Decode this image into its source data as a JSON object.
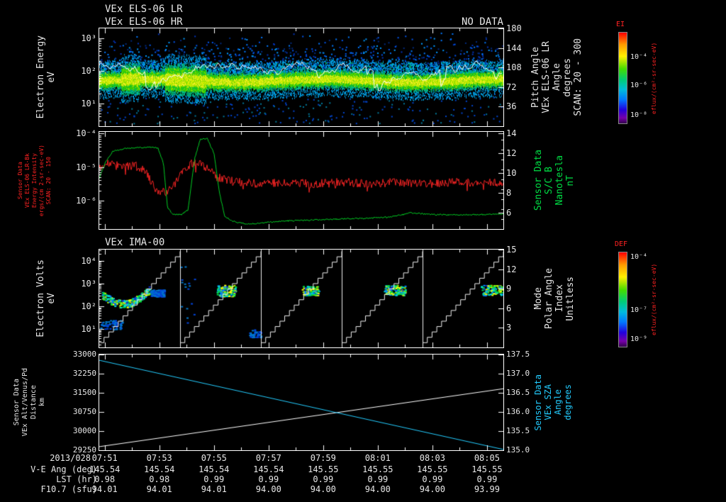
{
  "header": {
    "title_line1": "VEx ELS-06 LR",
    "title_line2": "VEx ELS-06 HR",
    "no_data": "NO DATA"
  },
  "panel_titles": {
    "ima": "VEx IMA-00"
  },
  "left_labels": {
    "els": [
      "Electron Energy",
      "eV"
    ],
    "bfield_red": [
      "Sensor Data",
      "VEx ELS-06 LR-Bk",
      "Energy Intensity",
      "ergs/(cm 2-sr-sec-eV)",
      "SCAN: 20 - 150"
    ],
    "ima": [
      "Electron Volts",
      "eV"
    ],
    "alt": [
      "Sensor Data",
      "VEx Alt/Venus/Pd",
      "Distance",
      "km"
    ]
  },
  "right_labels": {
    "els": [
      "Pitch Angle",
      "VEx ELS-06 LR",
      "Angle",
      "degrees",
      "SCAN: 20 - 300"
    ],
    "bfield": [
      "Sensor Data",
      "S/C B",
      "Nanotesla",
      "nT"
    ],
    "ima": [
      "Mode",
      "Polar Angle",
      "Index",
      "Unitless"
    ],
    "alt": [
      "Sensor Data",
      "VEx SZA",
      "Angle",
      "degrees"
    ]
  },
  "axis_ticks": {
    "els_left": [
      "10³",
      "10²",
      "10¹"
    ],
    "els_right": [
      "180",
      "144",
      "108",
      "72",
      "36"
    ],
    "bfield_left": [
      "10⁻⁴",
      "10⁻⁵",
      "10⁻⁶"
    ],
    "bfield_right": [
      "14",
      "12",
      "10",
      "8",
      "6"
    ],
    "ima_left": [
      "10⁴",
      "10³",
      "10²",
      "10¹"
    ],
    "ima_right": [
      "15",
      "12",
      "9",
      "6",
      "3"
    ],
    "alt_left": [
      "33000",
      "32250",
      "31500",
      "30750",
      "30000",
      "29250"
    ],
    "alt_right": [
      "137.5",
      "137.0",
      "136.5",
      "136.0",
      "135.5",
      "135.0"
    ]
  },
  "colorbars": [
    {
      "title": "EI",
      "ticks": [
        "10⁻⁴",
        "10⁻⁶",
        "10⁻⁸"
      ],
      "unit": "eflux/(cm²-sr-sec-eV)"
    },
    {
      "title": "DEF",
      "ticks": [
        "10⁻⁴",
        "10⁻⁷",
        "10⁻⁹"
      ],
      "unit": "eflux/(cm²-sr-sec-eV)"
    }
  ],
  "time_axis": {
    "date": "2013/028",
    "labels": [
      "07:51",
      "07:53",
      "07:55",
      "07:57",
      "07:59",
      "08:01",
      "08:03",
      "08:05"
    ]
  },
  "rows": [
    {
      "label": "V-E Ang (deg)",
      "values": [
        "145.54",
        "145.54",
        "145.54",
        "145.54",
        "145.55",
        "145.55",
        "145.55",
        "145.55"
      ]
    },
    {
      "label": "LST (hr)",
      "values": [
        "0.98",
        "0.98",
        "0.99",
        "0.99",
        "0.99",
        "0.99",
        "0.99",
        "0.99"
      ]
    },
    {
      "label": "F10.7 (sfu)",
      "values": [
        "94.01",
        "94.01",
        "94.01",
        "94.00",
        "94.00",
        "94.00",
        "94.00",
        "93.99"
      ]
    }
  ],
  "chart_data": [
    {
      "type": "heatmap",
      "name": "VEx ELS-06 LR electron energy spectrogram",
      "x_axis": {
        "start": "07:51",
        "end": "08:06",
        "units": "UT"
      },
      "ylog_range": [
        0.3,
        3.3
      ],
      "ytick_values": [
        3,
        2,
        1
      ],
      "y2_range": [
        0,
        180
      ],
      "y2tick_values": [
        180,
        144,
        108,
        72,
        36
      ],
      "features": {
        "band": {
          "log_e_center": 1.72,
          "log_e_halfwidth": 0.25,
          "note": "continuous bright yellow-green 30-100 eV electron band across whole interval"
        },
        "enhancements": [
          [
            0.8,
            1.5
          ],
          [
            2.4,
            3.9
          ]
        ],
        "speckle": {
          "log_e_range": [
            1.9,
            3.2
          ],
          "note": "sparse blue suprathermal counts up to ~1 keV"
        },
        "trace": {
          "note": "white line fluctuating near 100 eV"
        }
      }
    },
    {
      "type": "line",
      "name": "energy intensity and magnetic field",
      "yaxis_left": {
        "log_top": -3.95,
        "log_bottom": -6.85,
        "ytick_values": [
          -4,
          -5,
          -6
        ]
      },
      "yaxis_right": {
        "top": 14.14,
        "bottom": 4.36,
        "ytick_values": [
          14,
          12,
          10,
          8,
          6
        ]
      },
      "series": [
        {
          "name": "VEx ELS-06 LR-Bk Energy Intensity",
          "color": "#ee2222",
          "axis": "left",
          "noise": 0.13,
          "points": [
            [
              0,
              -4.95
            ],
            [
              0.4,
              -4.9
            ],
            [
              0.8,
              -5.0
            ],
            [
              1.3,
              -4.95
            ],
            [
              1.7,
              -5.15
            ],
            [
              2.1,
              -5.7
            ],
            [
              2.5,
              -5.75
            ],
            [
              2.8,
              -5.45
            ],
            [
              3.05,
              -5.1
            ],
            [
              3.3,
              -4.92
            ],
            [
              3.6,
              -4.88
            ],
            [
              3.9,
              -5.0
            ],
            [
              4.3,
              -5.3
            ],
            [
              5,
              -5.45
            ],
            [
              6,
              -5.5
            ],
            [
              7,
              -5.45
            ],
            [
              8,
              -5.5
            ],
            [
              9,
              -5.45
            ],
            [
              10,
              -5.5
            ],
            [
              11,
              -5.45
            ],
            [
              12,
              -5.5
            ],
            [
              13,
              -5.45
            ],
            [
              14,
              -5.5
            ],
            [
              14.8,
              -5.45
            ]
          ]
        },
        {
          "name": "S/C B",
          "color": "#00cc22",
          "axis": "right",
          "noise": 0.07,
          "points": [
            [
              0,
              9.5
            ],
            [
              0.25,
              11.2
            ],
            [
              0.5,
              12.2
            ],
            [
              0.9,
              12.45
            ],
            [
              1.4,
              12.55
            ],
            [
              1.9,
              12.6
            ],
            [
              2.15,
              12.5
            ],
            [
              2.35,
              11.0
            ],
            [
              2.5,
              6.5
            ],
            [
              2.7,
              5.85
            ],
            [
              3.0,
              5.8
            ],
            [
              3.25,
              6.3
            ],
            [
              3.5,
              11.5
            ],
            [
              3.7,
              13.4
            ],
            [
              3.95,
              13.5
            ],
            [
              4.2,
              12.0
            ],
            [
              4.4,
              8.0
            ],
            [
              4.6,
              5.6
            ],
            [
              4.9,
              5.15
            ],
            [
              5.4,
              4.85
            ],
            [
              5.9,
              4.95
            ],
            [
              6.4,
              5.1
            ],
            [
              7,
              5.2
            ],
            [
              7.6,
              5.25
            ],
            [
              8.2,
              5.3
            ],
            [
              9,
              5.4
            ],
            [
              9.8,
              5.45
            ],
            [
              10.6,
              5.55
            ],
            [
              11.1,
              5.8
            ],
            [
              11.4,
              6.0
            ],
            [
              11.8,
              5.9
            ],
            [
              12.4,
              5.8
            ],
            [
              13,
              5.78
            ],
            [
              13.6,
              5.8
            ],
            [
              14.2,
              5.82
            ],
            [
              14.8,
              5.85
            ]
          ]
        }
      ]
    },
    {
      "type": "heatmap",
      "name": "VEx IMA-00 ion energy spectrogram",
      "ylog_range": [
        0.19,
        4.5
      ],
      "ytick_values": [
        4,
        3,
        2,
        1
      ],
      "y2_range": [
        0,
        15
      ],
      "y2tick_values": [
        15,
        12,
        9,
        6,
        3
      ],
      "segments": 5,
      "sweep_steps": 17,
      "clusters": [
        {
          "seg": 0,
          "x0": 0.03,
          "x1": 0.62,
          "loge0": 1.95,
          "loge1": 2.65,
          "density": 0.5,
          "shape": "dip"
        },
        {
          "seg": 0,
          "x0": 0.0,
          "x1": 0.28,
          "loge0": 1.0,
          "loge1": 1.4,
          "density": 0.1
        },
        {
          "seg": 0,
          "x0": 0.62,
          "x1": 0.8,
          "loge0": 2.45,
          "loge1": 2.75,
          "density": 0.25
        },
        {
          "seg": 1,
          "x0": 0.45,
          "x1": 0.68,
          "loge0": 2.45,
          "loge1": 2.95,
          "density": 0.55
        },
        {
          "seg": 1,
          "x0": 0.0,
          "x1": 0.2,
          "loge0": 0.9,
          "loge1": 3.9,
          "density": 0.035
        },
        {
          "seg": 1,
          "x0": 0.85,
          "x1": 1.0,
          "loge0": 0.65,
          "loge1": 1.0,
          "density": 0.12
        },
        {
          "seg": 2,
          "x0": 0.5,
          "x1": 0.72,
          "loge0": 2.5,
          "loge1": 2.9,
          "density": 0.5
        },
        {
          "seg": 3,
          "x0": 0.52,
          "x1": 0.78,
          "loge0": 2.5,
          "loge1": 2.95,
          "density": 0.5
        },
        {
          "seg": 4,
          "x0": 0.72,
          "x1": 0.98,
          "loge0": 2.5,
          "loge1": 2.95,
          "density": 0.5
        }
      ]
    },
    {
      "type": "line",
      "name": "altitude and solar zenith angle",
      "yaxis_left": {
        "top": 33000,
        "bottom": 29250,
        "ytick_values": [
          33000,
          32250,
          31500,
          30750,
          30000,
          29250
        ]
      },
      "yaxis_right": {
        "top": 137.5,
        "bottom": 135.0,
        "ytick_values": [
          137.5,
          137.0,
          136.5,
          136.0,
          135.5,
          135.0
        ]
      },
      "series": [
        {
          "name": "VEx Alt/Venus/Pd Distance",
          "color": "#ffffff",
          "axis": "left",
          "points": [
            [
              0,
              29390
            ],
            [
              14.8,
              31660
            ]
          ]
        },
        {
          "name": "VEx SZA",
          "color": "#22ccff",
          "axis": "right",
          "points": [
            [
              0,
              137.35
            ],
            [
              14.8,
              135.02
            ]
          ]
        }
      ]
    }
  ]
}
